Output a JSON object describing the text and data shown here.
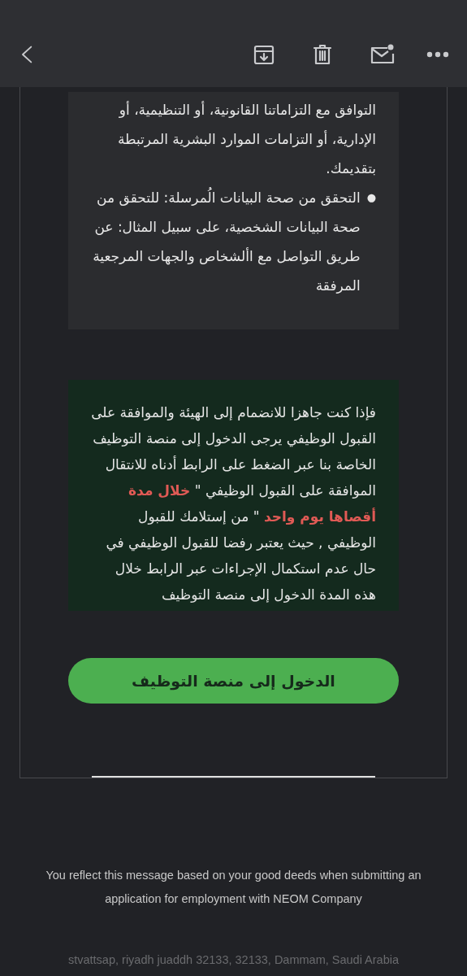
{
  "notice_card": {
    "paragraphs": [
      {
        "kind": "continuation",
        "text": "التوافق مع التزاماتنا القانونية، أو التنظيمية، أو الإدارية، أو التزامات الموارد البشرية المرتبطة بتقديمك."
      },
      {
        "kind": "bullet",
        "bullet": "●",
        "text": "التحقق من صحة البيانات الُمرسلة: للتحقق من صحة البيانات الشخصية، على سبيل المثال: عن طريق التواصل مع األشخاص والجهات المرجعية المرفقة"
      }
    ]
  },
  "offer_box": {
    "segments": [
      {
        "text": "فإذا كنت جاهزا للانضمام إلى الهيئة والموافقة على القبول الوظيفي يرجى الدخول إلى منصة التوظيف الخاصة بنا عبر الضغط على الرابط أدناه للانتقال الموافقة على القبول الوظيفي \" ",
        "highlight": false
      },
      {
        "text": "خلال مدة أقصاها يوم واحد",
        "highlight": true
      },
      {
        "text": " \" من إستلامك للقبول الوظيفي , حيث يعتبر رفضا للقبول الوظيفي في حال عدم استكمال الإجراءات  عبر الرابط خلال هذه المدة   الدخول إلى منصة التوظيف",
        "highlight": false
      }
    ]
  },
  "action_button": {
    "label": "الدخول إلى منصة التوظيف"
  },
  "footer": {
    "note": "You reflect this message based on your good deeds when submitting an application for employment with NEOM Company",
    "address": "stvattsap, riyadh juaddh 32133, 32133, Dammam, Saudi Arabia"
  }
}
